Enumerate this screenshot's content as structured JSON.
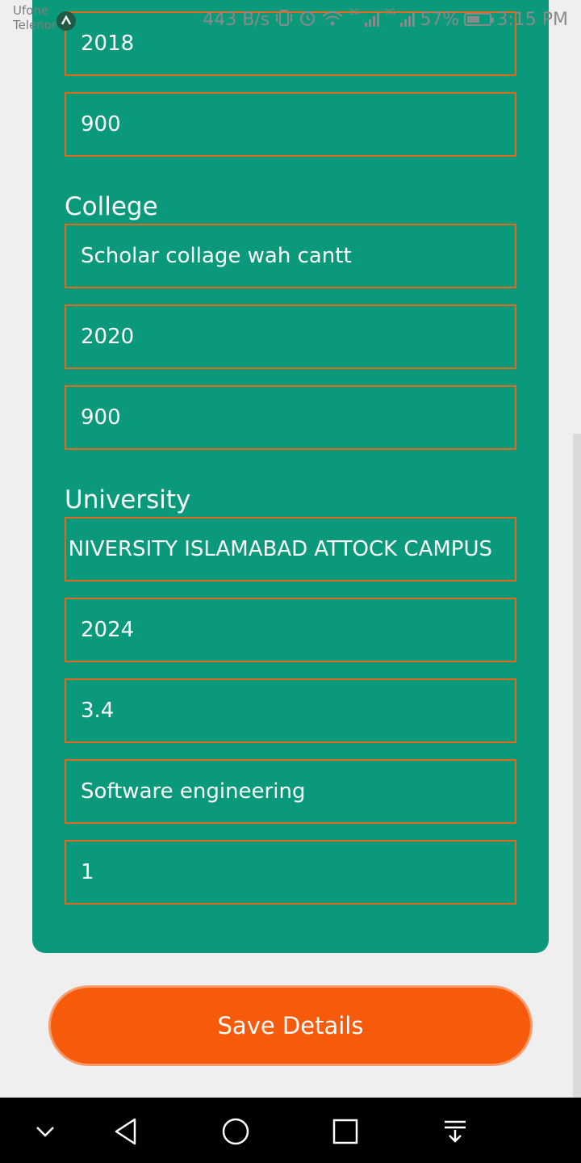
{
  "status_bar": {
    "carrier_1": "Ufone",
    "carrier_2": "Telenor",
    "network_speed": "443 B/s",
    "network_type_1": "3G",
    "network_type_2": "3G",
    "battery_percent": "57%",
    "battery_level": 0.57,
    "time": "3:15 PM",
    "icons": [
      "app-notification-icon",
      "vibrate-icon",
      "alarm-icon",
      "wifi-icon",
      "signal-icon",
      "signal-icon",
      "battery-icon"
    ]
  },
  "school": {
    "year": "2018",
    "marks": "900"
  },
  "college": {
    "heading": "College",
    "name": "Scholar collage wah cantt",
    "year": "2020",
    "marks": "900"
  },
  "university": {
    "heading": "University",
    "name": "NIVERSITY ISLAMABAD ATTOCK CAMPUS",
    "year": "2024",
    "cgpa": "3.4",
    "program": "Software engineering",
    "semester": "1"
  },
  "actions": {
    "save_label": "Save Details"
  },
  "nav_bar": {
    "icons": [
      "chevron-down-icon",
      "back-icon",
      "home-icon",
      "recents-icon",
      "notification-pull-icon"
    ]
  },
  "colors": {
    "card_background": "#0a997a",
    "field_border": "#e16a1c",
    "button_background": "#f65a0b",
    "page_background": "#efefef"
  }
}
